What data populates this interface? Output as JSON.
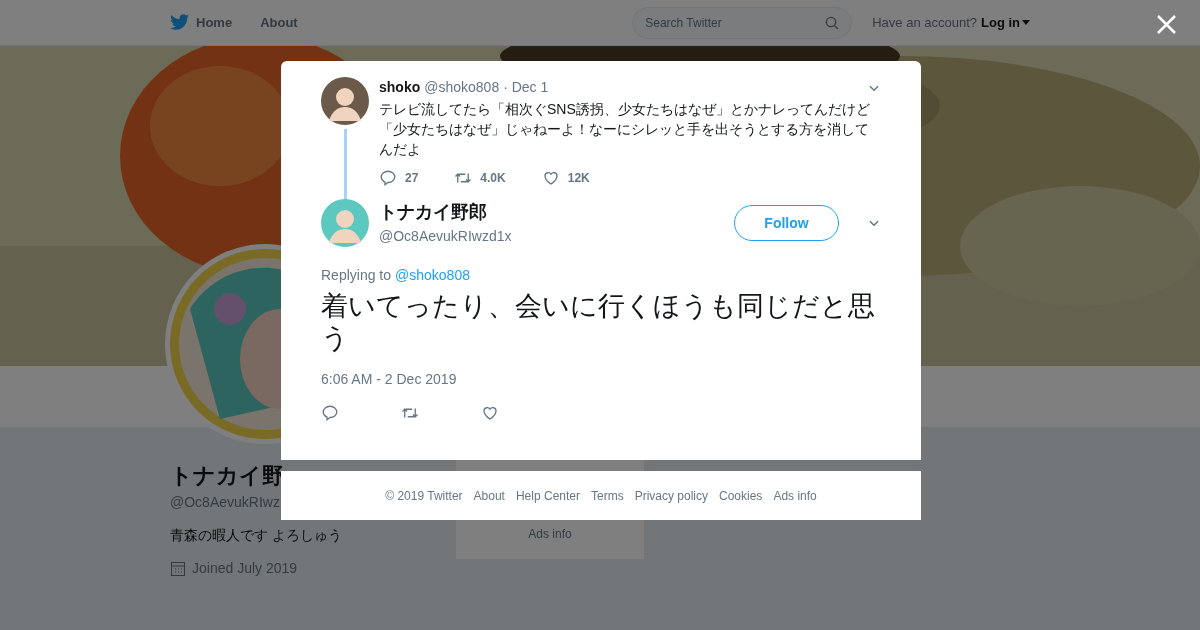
{
  "nav": {
    "items": [
      {
        "label": "Home",
        "kind": "logo"
      },
      {
        "label": "About"
      }
    ],
    "search": {
      "placeholder": "Search Twitter"
    },
    "account_prompt": "Have an account?",
    "login": "Log in"
  },
  "profile": {
    "name": "トナカイ野",
    "handle": "@Oc8AevukRIwz",
    "bio": "青森の暇人です よろしゅう",
    "joined": "Joined July 2019"
  },
  "side_card": {
    "links": [
      "Ads info"
    ]
  },
  "modal": {
    "parent_tweet": {
      "name": "shoko",
      "handle": "@shoko808",
      "date": "· Dec 1",
      "text": "テレビ流してたら「相次ぐSNS誘拐、少女たちはなぜ」とかナレってんだけど「少女たちはなぜ」じゃねーよ！なーにシレッと手を出そうとする方を消してんだよ",
      "actions": [
        {
          "kind": "reply",
          "count": "27"
        },
        {
          "kind": "retweet",
          "count": "4.0K"
        },
        {
          "kind": "like",
          "count": "12K"
        }
      ]
    },
    "tweet": {
      "name": "トナカイ野郎",
      "handle": "@Oc8AevukRIwzd1x",
      "follow": "Follow",
      "replying_label": "Replying to",
      "replying_to": "@shoko808",
      "text": "着いてったり、会いに行くほうも同じだと思う",
      "time": "6:06 AM - 2 Dec 2019",
      "actions": [
        {
          "kind": "reply"
        },
        {
          "kind": "retweet"
        },
        {
          "kind": "like"
        }
      ]
    }
  },
  "footer": {
    "links": [
      "© 2019 Twitter",
      "About",
      "Help Center",
      "Terms",
      "Privacy policy",
      "Cookies",
      "Ads info"
    ]
  }
}
